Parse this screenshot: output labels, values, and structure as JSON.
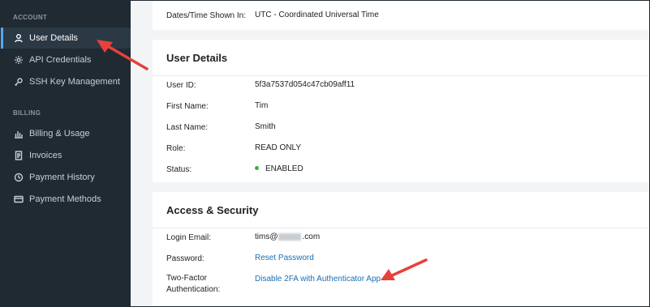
{
  "sidebar": {
    "account_section": "ACCOUNT",
    "billing_section": "BILLING",
    "items": [
      {
        "label": "User Details",
        "icon": "user-icon"
      },
      {
        "label": "API Credentials",
        "icon": "gear-icon"
      },
      {
        "label": "SSH Key Management",
        "icon": "key-icon"
      },
      {
        "label": "Billing & Usage",
        "icon": "bar-chart-icon"
      },
      {
        "label": "Invoices",
        "icon": "document-icon"
      },
      {
        "label": "Payment History",
        "icon": "history-icon"
      },
      {
        "label": "Payment Methods",
        "icon": "credit-card-icon"
      }
    ]
  },
  "preferences": {
    "dates_label": "Dates/Time Shown In:",
    "dates_value": "UTC - Coordinated Universal Time"
  },
  "user_details": {
    "title": "User Details",
    "user_id_label": "User ID:",
    "user_id_value": "5f3a7537d054c47cb09aff11",
    "first_name_label": "First Name:",
    "first_name_value": "Tim",
    "last_name_label": "Last Name:",
    "last_name_value": "Smith",
    "role_label": "Role:",
    "role_value": "READ ONLY",
    "status_label": "Status:",
    "status_value": "ENABLED"
  },
  "access_security": {
    "title": "Access & Security",
    "login_email_label": "Login Email:",
    "login_email_prefix": "tims@",
    "login_email_suffix": ".com",
    "password_label": "Password:",
    "password_link": "Reset Password",
    "two_factor_label_line1": "Two-Factor",
    "two_factor_label_line2": "Authentication:",
    "two_factor_link": "Disable 2FA with Authenticator App"
  },
  "colors": {
    "sidebar_bg": "#1f2a33",
    "link": "#1a6fb3",
    "status_green": "#3cb043",
    "annotation_arrow": "#e8403a"
  }
}
